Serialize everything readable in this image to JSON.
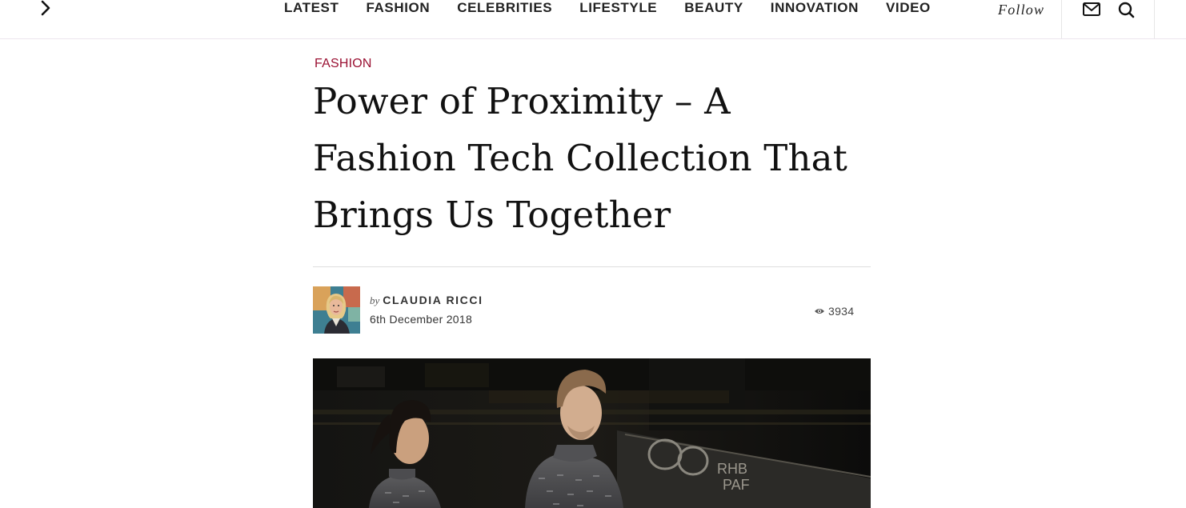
{
  "nav": {
    "items": [
      "LATEST",
      "FASHION",
      "CELEBRITIES",
      "LIFESTYLE",
      "BEAUTY",
      "INNOVATION",
      "VIDEO"
    ],
    "follow_label": "Follow",
    "icons": [
      "chevron-right-icon",
      "mail-icon",
      "search-icon"
    ]
  },
  "article": {
    "category": "FASHION",
    "title": "Power of Proximity – A Fashion Tech Collection That Brings Us Together",
    "byline_prefix": "by",
    "author": "CLAUDIA RICCI",
    "date": "6th December 2018",
    "views": "3934",
    "hero_graffiti": "RHB PAF"
  },
  "colors": {
    "category_accent": "#9a1032",
    "text": "#111111",
    "nav_text": "#222222",
    "divider": "#dedede"
  }
}
